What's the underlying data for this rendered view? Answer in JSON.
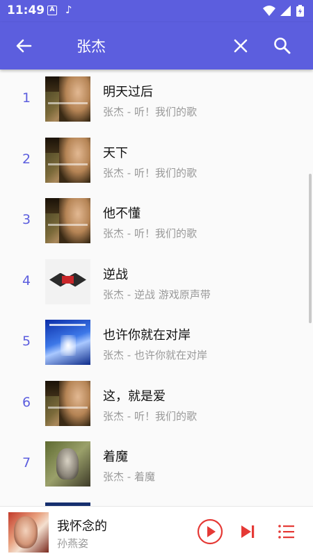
{
  "status_bar": {
    "time": "11:49",
    "icon_a": "A",
    "icon_note": "♪"
  },
  "app_bar": {
    "search_query": "张杰",
    "back_icon": "arrow-left-icon",
    "clear_icon": "close-icon",
    "search_icon": "search-icon"
  },
  "songs": [
    {
      "index": "1",
      "title": "明天过后",
      "subtitle": "张杰 - 听！我们的歌",
      "cover": "listen"
    },
    {
      "index": "2",
      "title": "天下",
      "subtitle": "张杰 - 听！我们的歌",
      "cover": "listen"
    },
    {
      "index": "3",
      "title": "他不懂",
      "subtitle": "张杰 - 听！我们的歌",
      "cover": "listen"
    },
    {
      "index": "4",
      "title": "逆战",
      "subtitle": "张杰 - 逆战 游戏原声带",
      "cover": "war"
    },
    {
      "index": "5",
      "title": "也许你就在对岸",
      "subtitle": "张杰 - 也许你就在对岸",
      "cover": "shore"
    },
    {
      "index": "6",
      "title": "这，就是爱",
      "subtitle": "张杰 - 听！我们的歌",
      "cover": "listen"
    },
    {
      "index": "7",
      "title": "着魔",
      "subtitle": "张杰 - 着魔",
      "cover": "mo"
    }
  ],
  "player": {
    "title": "我怀念的",
    "artist": "孙燕姿"
  },
  "colors": {
    "primary": "#5c5ede",
    "accent_red": "#e53935",
    "index_color": "#5c5ede"
  }
}
